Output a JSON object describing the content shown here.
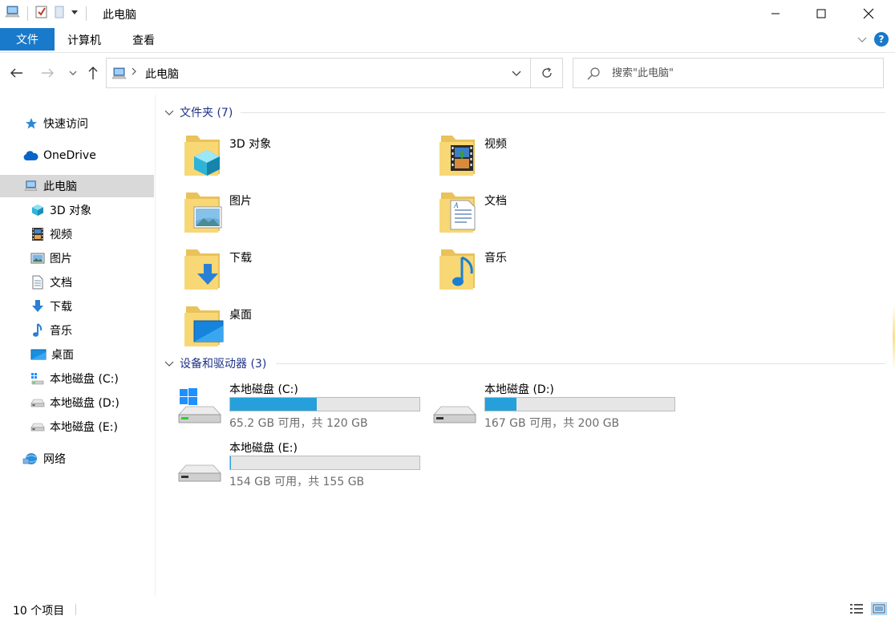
{
  "window": {
    "title": "此电脑",
    "controls": {
      "minimize": "minimize",
      "maximize": "maximize",
      "close": "close"
    }
  },
  "ribbon": {
    "tabs": [
      {
        "label": "文件",
        "active": true
      },
      {
        "label": "计算机"
      },
      {
        "label": "查看"
      }
    ],
    "help": "?"
  },
  "navbar": {
    "breadcrumb": "此电脑",
    "search_placeholder": "搜索\"此电脑\""
  },
  "sidebar": {
    "items": [
      {
        "label": "快速访问",
        "icon": "star-icon"
      },
      {
        "label": "OneDrive",
        "icon": "cloud-icon"
      },
      {
        "label": "此电脑",
        "icon": "computer-icon",
        "selected": true
      },
      {
        "label": "3D 对象",
        "icon": "cube-icon"
      },
      {
        "label": "视频",
        "icon": "video-icon"
      },
      {
        "label": "图片",
        "icon": "picture-icon"
      },
      {
        "label": "文档",
        "icon": "document-icon"
      },
      {
        "label": "下载",
        "icon": "download-icon"
      },
      {
        "label": "音乐",
        "icon": "music-icon"
      },
      {
        "label": "桌面",
        "icon": "desktop-icon"
      },
      {
        "label": "本地磁盘 (C:)",
        "icon": "windows-drive-icon"
      },
      {
        "label": "本地磁盘 (D:)",
        "icon": "drive-icon"
      },
      {
        "label": "本地磁盘 (E:)",
        "icon": "drive-icon"
      },
      {
        "label": "网络",
        "icon": "network-icon"
      }
    ]
  },
  "content": {
    "folders_header": "文件夹 (7)",
    "folders": [
      {
        "label": "3D 对象",
        "icon": "cube-icon"
      },
      {
        "label": "视频",
        "icon": "video-icon"
      },
      {
        "label": "图片",
        "icon": "picture-icon"
      },
      {
        "label": "文档",
        "icon": "document-icon"
      },
      {
        "label": "下载",
        "icon": "download-icon"
      },
      {
        "label": "音乐",
        "icon": "music-icon"
      },
      {
        "label": "桌面",
        "icon": "desktop-icon"
      }
    ],
    "devices_header": "设备和驱动器 (3)",
    "drives": [
      {
        "name": "本地磁盘 (C:)",
        "info": "65.2 GB 可用，共 120 GB",
        "used_fraction": 0.457,
        "icon": "windows-drive-icon"
      },
      {
        "name": "本地磁盘 (D:)",
        "info": "167 GB 可用，共 200 GB",
        "used_fraction": 0.165,
        "icon": "drive-icon"
      },
      {
        "name": "本地磁盘 (E:)",
        "info": "154 GB 可用，共 155 GB",
        "used_fraction": 0.006,
        "icon": "drive-icon"
      }
    ]
  },
  "statusbar": {
    "count": "10 个项目"
  },
  "colors": {
    "accent": "#1979ca",
    "bar_fill": "#26a0da",
    "group_header": "#1e3287",
    "folder": "#f8d775"
  }
}
